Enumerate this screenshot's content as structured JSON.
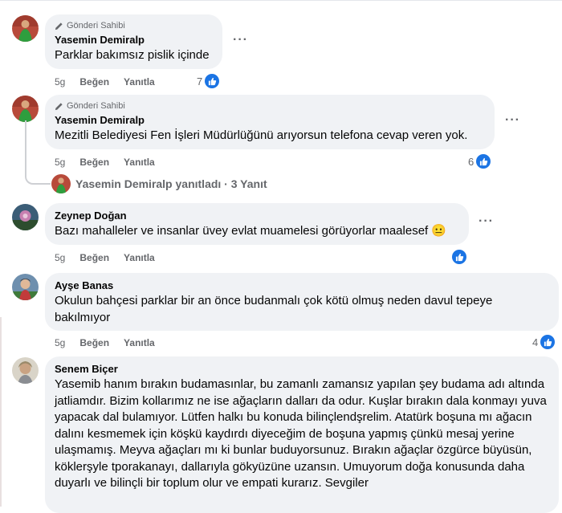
{
  "comments": [
    {
      "badge": "Gönderi Sahibi",
      "name": "Yasemin Demiralp",
      "text": "Parklar bakımsız pislik içinde",
      "time": "5g",
      "like": "Beğen",
      "reply": "Yanıtla",
      "count": "7"
    },
    {
      "badge": "Gönderi Sahibi",
      "name": "Yasemin Demiralp",
      "text": "Mezitli Belediyesi Fen İşleri Müdürlüğünü arıyorsun telefona cevap veren yok.",
      "time": "5g",
      "like": "Beğen",
      "reply": "Yanıtla",
      "count": "6"
    },
    {
      "name": "Zeynep Doğan",
      "text": "Bazı mahalleler ve insanlar üvey evlat muamelesi görüyorlar maalesef 😐",
      "time": "5g",
      "like": "Beğen",
      "reply": "Yanıtla"
    },
    {
      "name": "Ayşe Banas",
      "text": "Okulun bahçesi parklar bir an önce budanmalı çok kötü olmuş neden davul tepeye bakılmıyor",
      "time": "5g",
      "like": "Beğen",
      "reply": "Yanıtla",
      "count": "4"
    },
    {
      "name": "Senem Biçer",
      "text": "Yasemib hanım bırakın budamasınlar, bu zamanlı zamansız yapılan şey budama adı altında jatliamdır. Bizim kollarımız ne ise ağaçların dalları da odur. Kuşlar bırakın dala konmayı yuva yapacak dal bulamıyor. Lütfen halkı bu konuda bilinçlendşrelim. Atatürk boşuna mı ağacın dalını kesmemek için köşkü kaydırdı diyeceğim de boşuna yapmış çünkü mesaj yerine ulaşmamış. Meyva ağaçları mı ki bunlar buduyorsunuz. Bırakın ağaçlar özgürce büyüsün, köklerşyle tporakanayı, dallarıyla gökyüzüne uzansın. Umuyorum doğa konusunda daha duyarlı ve bilinçli bir toplum olur ve empati kurarız. Sevgiler"
    }
  ],
  "replies_label": "Yasemin Demiralp yanıtladı · 3 Yanıt",
  "icons": {
    "badge": "pencil-icon",
    "like": "thumbs-up-icon",
    "more": "more-dots-icon"
  },
  "colors": {
    "like_blue": "#1b74e4",
    "bubble": "#f0f2f5",
    "secondary_text": "#65676b"
  }
}
